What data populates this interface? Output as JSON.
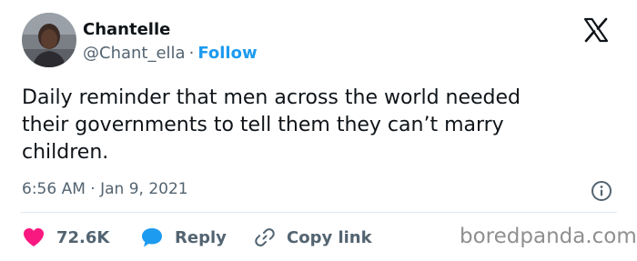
{
  "author": {
    "name": "Chantelle",
    "handle": "@Chant_ella",
    "separator": "·",
    "follow_label": "Follow"
  },
  "tweet": {
    "lines": [
      "Daily reminder that men across the world needed",
      "their governments to tell them they can’t marry",
      "children."
    ],
    "timestamp": "6:56 AM · Jan 9, 2021"
  },
  "actions": {
    "likes_count": "72.6K",
    "reply_label": "Reply",
    "copy_link_label": "Copy link"
  },
  "icons": {
    "logo": "x-logo-icon",
    "info": "info-icon",
    "like": "heart-icon",
    "reply": "speech-bubble-icon",
    "copy": "link-icon"
  },
  "watermark": "boredpanda.com",
  "colors": {
    "text": "#0f1419",
    "secondary": "#536471",
    "accent": "#1d9bf0",
    "like": "#f91880",
    "divider": "#e1e8ed"
  }
}
